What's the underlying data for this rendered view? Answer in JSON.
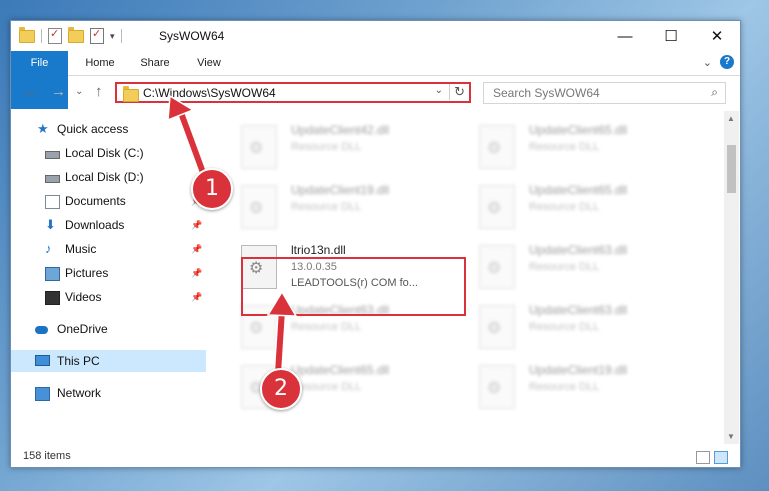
{
  "window": {
    "title": "SysWOW64"
  },
  "ribbon": {
    "tabs": [
      "File",
      "Home",
      "Share",
      "View"
    ],
    "expand_glyph": "⌄",
    "help_glyph": "?"
  },
  "nav": {
    "back_glyph": "←",
    "forward_glyph": "→",
    "recent_glyph": "⌄",
    "up_glyph": "↑",
    "address": "C:\\Windows\\SysWOW64",
    "search_placeholder": "Search SysWOW64"
  },
  "sidebar": {
    "items": [
      {
        "label": "Quick access"
      },
      {
        "label": "Local Disk (C:)"
      },
      {
        "label": "Local Disk (D:)"
      },
      {
        "label": "Documents"
      },
      {
        "label": "Downloads"
      },
      {
        "label": "Music"
      },
      {
        "label": "Pictures"
      },
      {
        "label": "Videos"
      },
      {
        "label": "OneDrive"
      },
      {
        "label": "This PC"
      },
      {
        "label": "Network"
      }
    ]
  },
  "files": {
    "highlighted": {
      "name": "ltrio13n.dll",
      "version": "13.0.0.35",
      "description": "LEADTOOLS(r) COM fo..."
    },
    "blurred": [
      {
        "name": "UpdateClient42.dll",
        "type": "Resource DLL"
      },
      {
        "name": "UpdateClient65.dll",
        "type": "Resource DLL"
      },
      {
        "name": "UpdateClient19.dll",
        "type": "Resource DLL"
      },
      {
        "name": "UpdateClient65.dll",
        "type": "Resource DLL"
      },
      {
        "name": "UpdateClient63.dll",
        "type": "Resource DLL"
      },
      {
        "name": "UpdateClient63.dll",
        "type": "Resource DLL"
      },
      {
        "name": "UpdateClient63.dll",
        "type": "Resource DLL"
      },
      {
        "name": "UpdateClient65.dll",
        "type": "Resource DLL"
      },
      {
        "name": "UpdateClient19.dll",
        "type": "Resource DLL"
      }
    ]
  },
  "status": {
    "count": "158 items"
  },
  "annotations": {
    "step1": "1",
    "step2": "2",
    "color": "#d9323a"
  }
}
